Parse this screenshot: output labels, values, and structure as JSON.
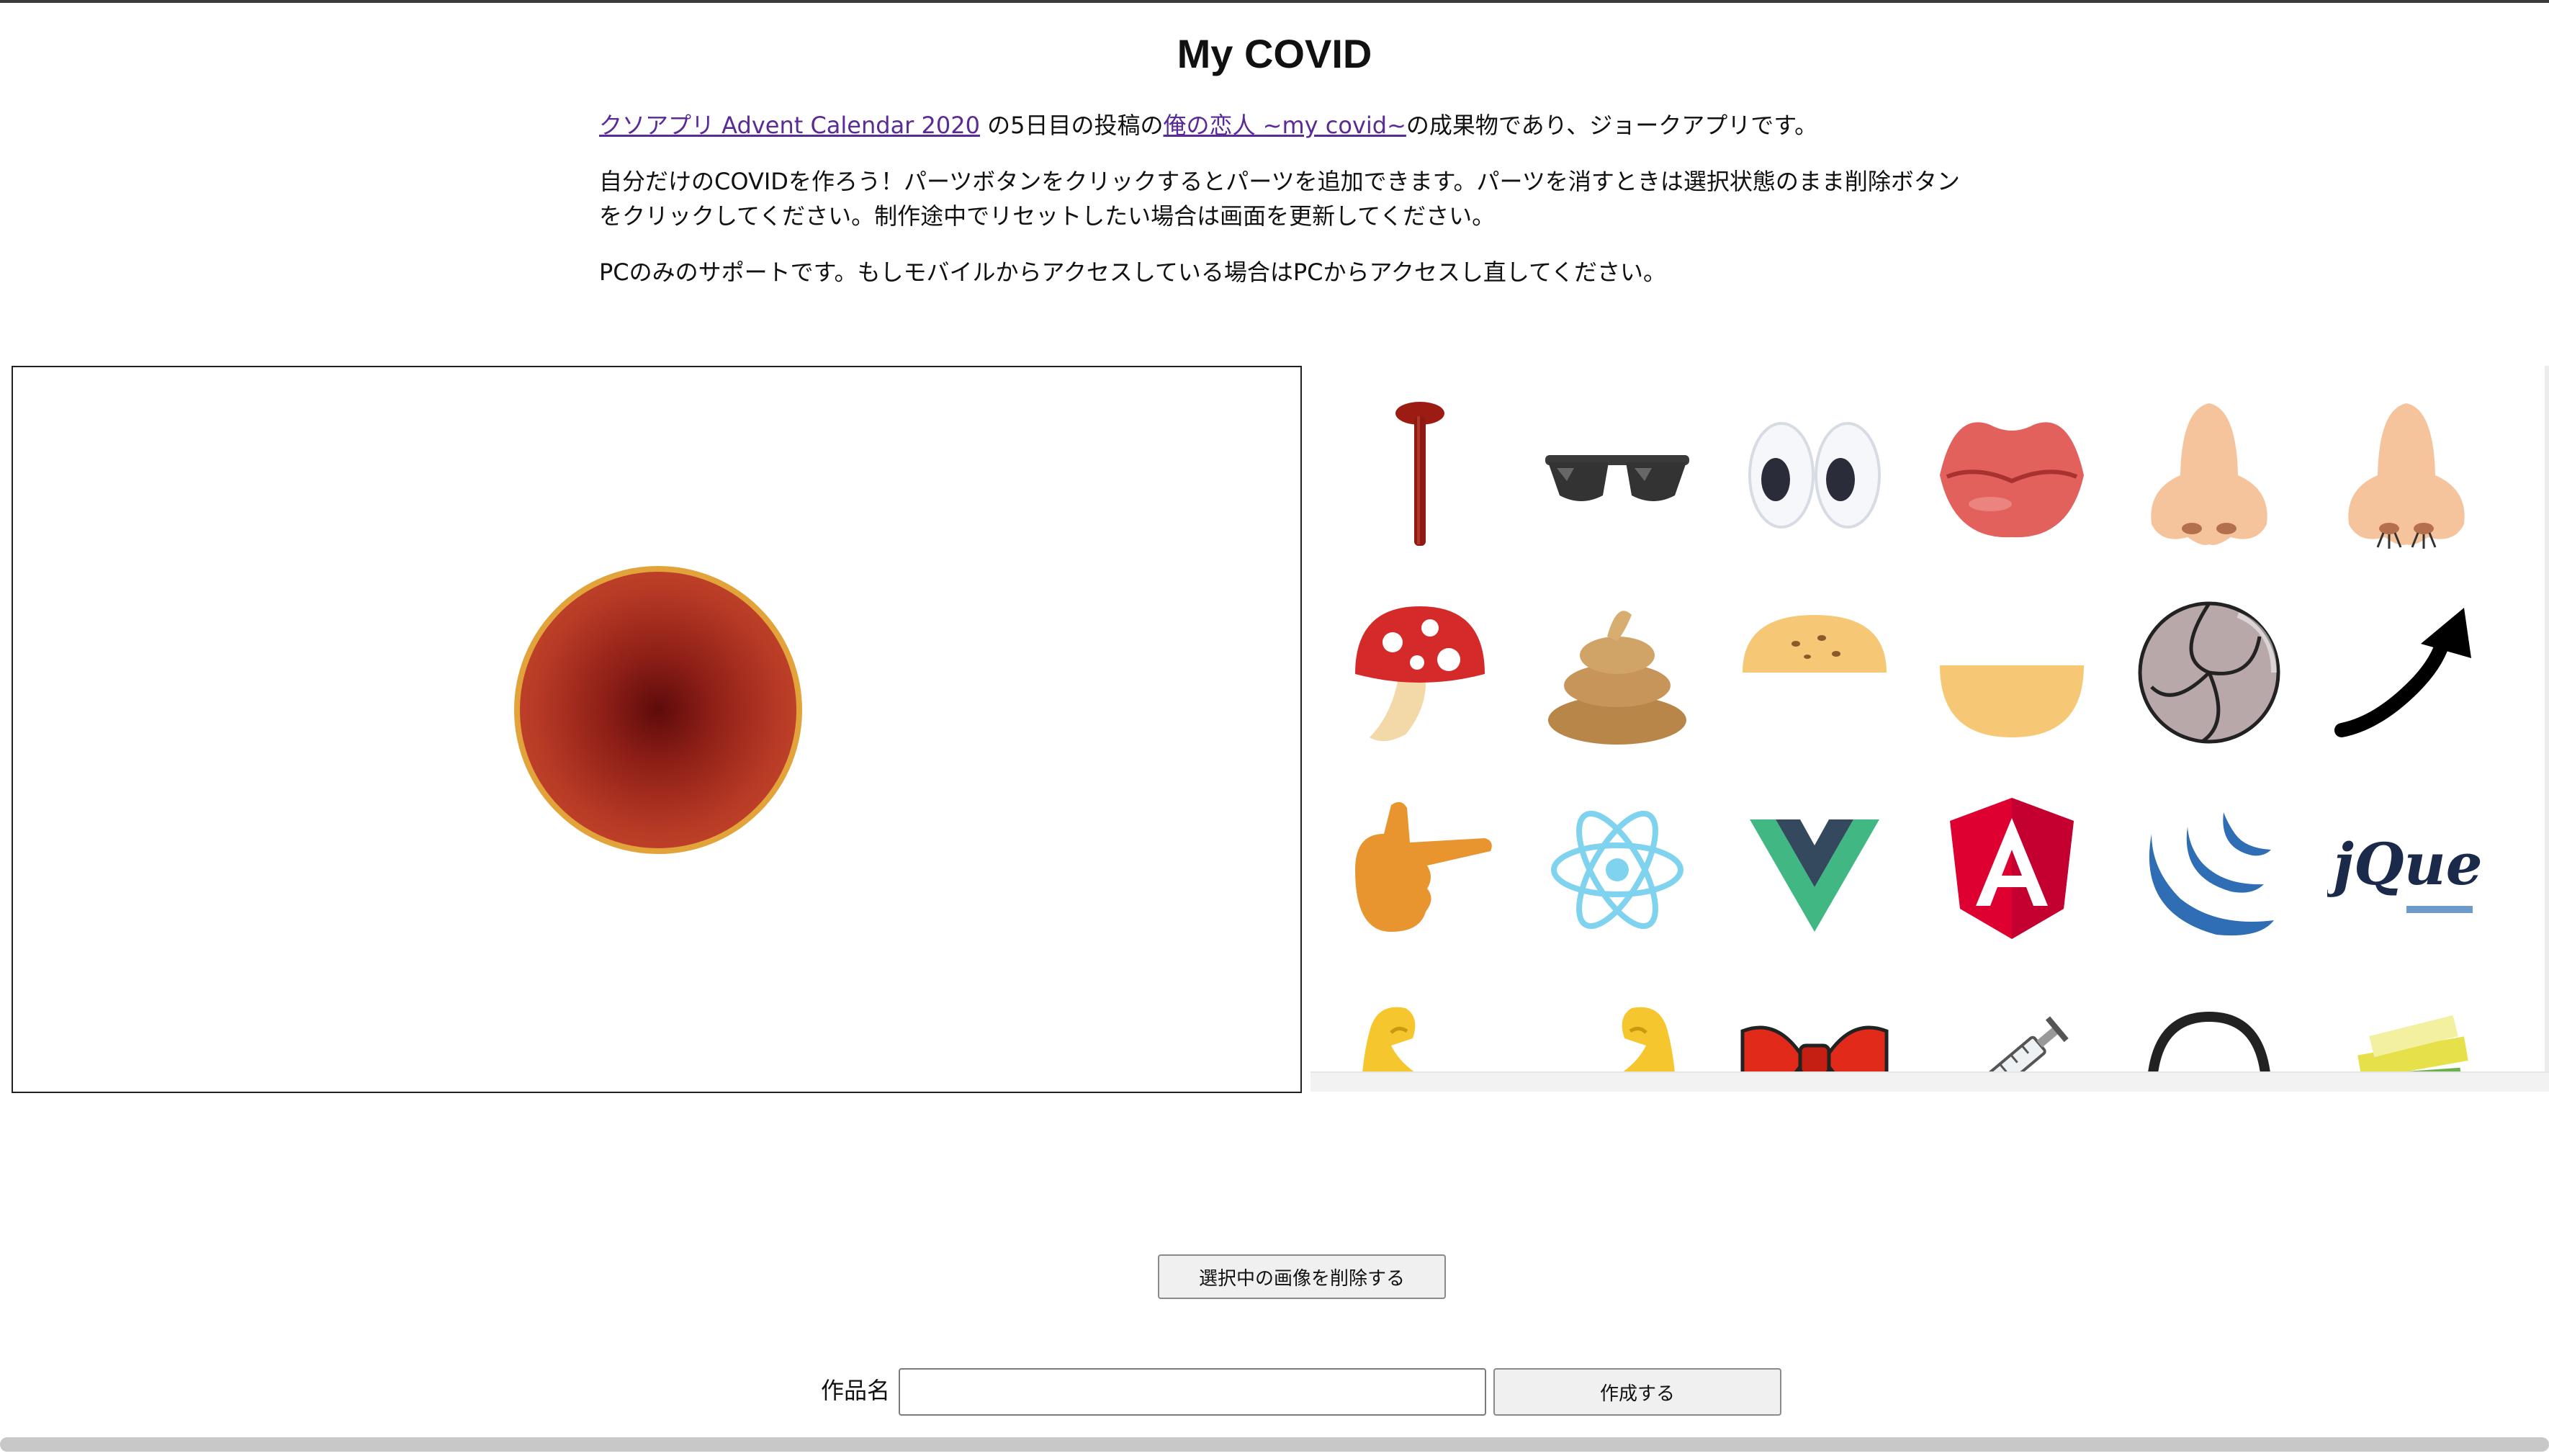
{
  "page": {
    "title": "My COVID"
  },
  "intro": {
    "line1_link1": "クソアプリ Advent Calendar 2020",
    "line1_text1": " の5日目の投稿の",
    "line1_link2": "俺の恋人 ~my covid~",
    "line1_text2": "の成果物であり、ジョークアプリです。",
    "line2": "自分だけのCOVIDを作ろう！パーツボタンをクリックするとパーツを追加できます。パーツを消すときは選択状態のまま削除ボタンをクリックしてください。制作途中でリセットしたい場合は画面を更新してください。",
    "line3": "PCのみのサポートです。もしモバイルからアクセスしている場合はPCからアクセスし直してください。"
  },
  "canvas": {
    "virus_colors": {
      "core": "#5e0b0b",
      "outer": "#c94a2e",
      "rim": "#e2a43a"
    }
  },
  "parts": [
    {
      "icon": "nail-icon"
    },
    {
      "icon": "sunglasses-icon"
    },
    {
      "icon": "eyes-icon"
    },
    {
      "icon": "lips-icon"
    },
    {
      "icon": "nose-icon"
    },
    {
      "icon": "nose-hair-icon"
    },
    {
      "icon": "mushroom-icon"
    },
    {
      "icon": "poop-icon"
    },
    {
      "icon": "bun-top-icon"
    },
    {
      "icon": "bun-bottom-icon"
    },
    {
      "icon": "shell-icon"
    },
    {
      "icon": "arrow-icon"
    },
    {
      "icon": "pointing-hand-icon"
    },
    {
      "icon": "react-logo-icon"
    },
    {
      "icon": "vue-logo-icon"
    },
    {
      "icon": "angular-logo-icon"
    },
    {
      "icon": "jquery-swirl-icon"
    },
    {
      "icon": "jquery-wordmark-icon"
    },
    {
      "icon": "flexed-bicep-left-icon"
    },
    {
      "icon": "flexed-bicep-right-icon"
    },
    {
      "icon": "bow-tie-icon"
    },
    {
      "icon": "syringe-icon"
    },
    {
      "icon": "headphones-icon"
    },
    {
      "icon": "books-icon"
    }
  ],
  "actions": {
    "delete_label": "選択中の画像を削除する",
    "name_label": "作品名",
    "name_value": "",
    "create_label": "作成する"
  }
}
